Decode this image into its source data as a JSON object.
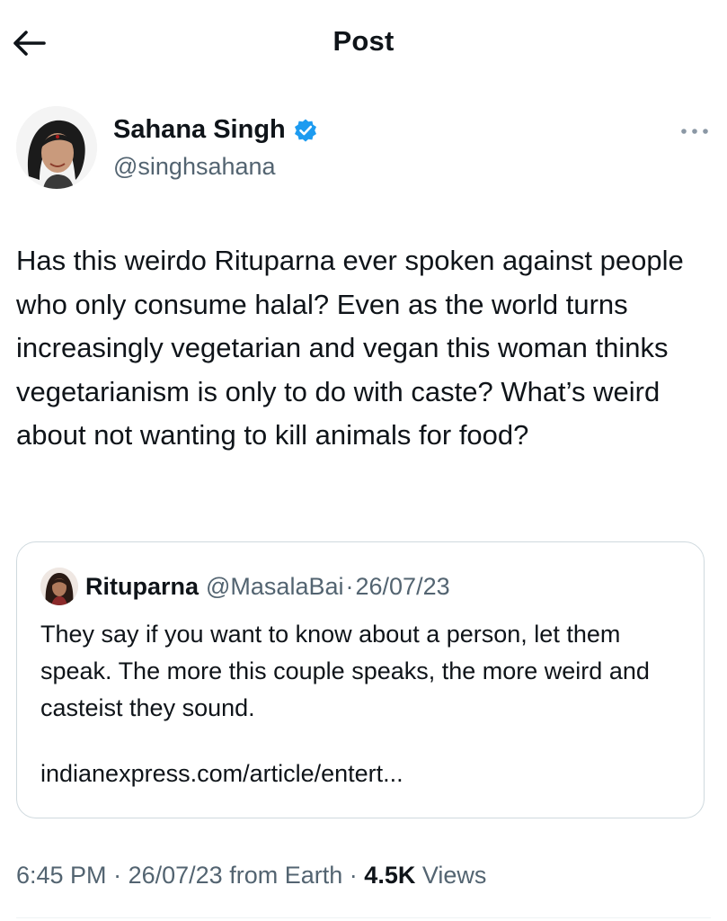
{
  "header": {
    "title": "Post",
    "back_icon": "arrow-left-icon"
  },
  "author": {
    "name": "Sahana Singh",
    "handle": "@singhsahana",
    "verified": true,
    "verified_color": "#1d9bf0",
    "more_icon": "more-horizontal-icon"
  },
  "tweet": {
    "text": "Has this weirdo Rituparna ever spoken against people who only consume halal? Even as the world turns increasingly vegetarian and vegan this woman thinks vegetarianism is only to do with caste? What’s weird about not wanting to kill animals for food?"
  },
  "quote": {
    "name": "Rituparna",
    "handle": "@MasalaBai",
    "separator": "·",
    "date": "26/07/23",
    "text": "They say if you want to know about a person, let them speak. The more this couple speaks, the more weird and casteist they sound.",
    "url": "indianexpress.com/article/entert..."
  },
  "meta": {
    "time": "6:45 PM",
    "separator": "·",
    "date": "26/07/23",
    "source": "from Earth",
    "views_count": "4.5K",
    "views_label": "Views"
  },
  "colors": {
    "text_primary": "#0f1419",
    "text_secondary": "#536471",
    "border": "#cfd9de",
    "accent": "#1d9bf0"
  }
}
